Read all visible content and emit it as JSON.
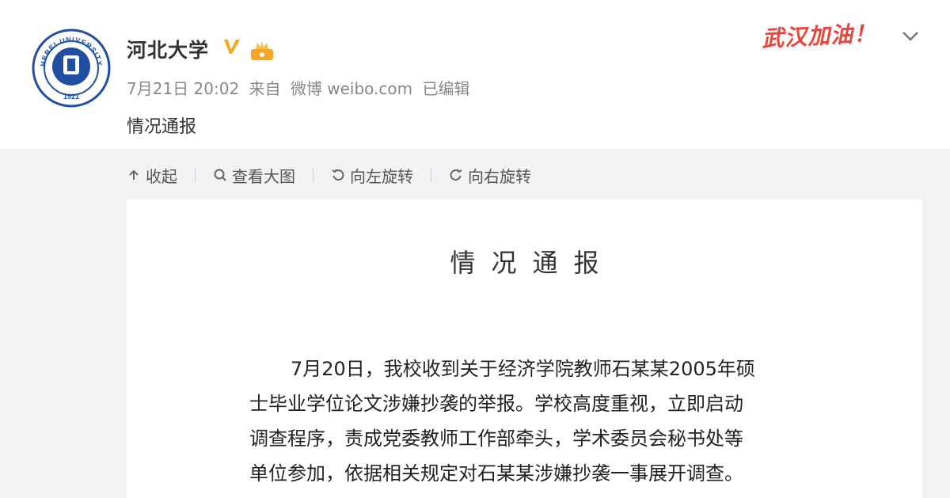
{
  "post": {
    "username": "河北大学",
    "date": "7月21日 20:02",
    "source_prefix": "来自",
    "source": "微博 weibo.com",
    "edited": "已编辑",
    "text": "情况通报",
    "slogan": "武汉加油！",
    "avatar_text": "HEBEI UNIVERSITY",
    "avatar_year": "1921"
  },
  "toolbar": {
    "collapse": "收起",
    "view_large": "查看大图",
    "rotate_left": "向左旋转",
    "rotate_right": "向右旋转"
  },
  "document": {
    "title": "情况通报",
    "lines": [
      "7月20日，我校收到关于经济学院教师石某某2005年硕",
      "士毕业学位论文涉嫌抄袭的举报。学校高度重视，立即启动",
      "调查程序，责成党委教师工作部牵头，学术委员会秘书处等",
      "单位参加，依据相关规定对石某某涉嫌抄袭一事展开调查。"
    ]
  },
  "colors": {
    "verified": "#f5a623",
    "slogan": "#e8463c",
    "avatar_blue": "#1f4ea3",
    "media_bg": "#f2f2f5"
  }
}
